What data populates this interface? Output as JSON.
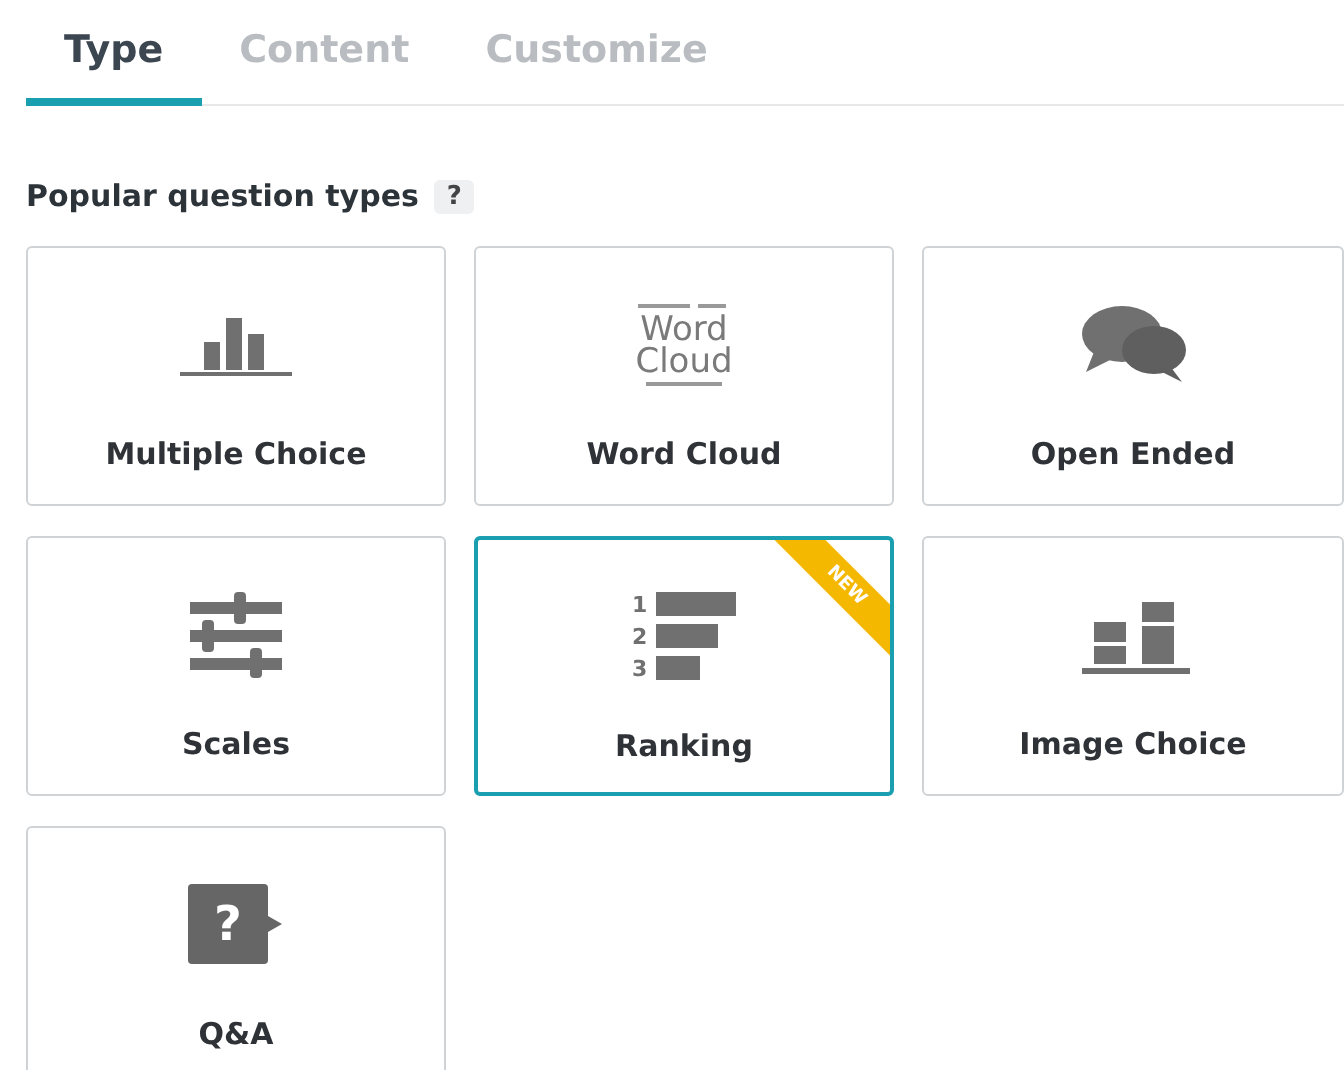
{
  "tabs": [
    {
      "label": "Type",
      "selected": true
    },
    {
      "label": "Content",
      "selected": false
    },
    {
      "label": "Customize",
      "selected": false
    }
  ],
  "section": {
    "title": "Popular question types",
    "help": "?"
  },
  "cards": [
    {
      "label": "Multiple Choice",
      "kind": "bars",
      "selected": false
    },
    {
      "label": "Word Cloud",
      "kind": "wordcloud",
      "selected": false,
      "icon_text": [
        "Word",
        "Cloud"
      ]
    },
    {
      "label": "Open Ended",
      "kind": "speech",
      "selected": false
    },
    {
      "label": "Scales",
      "kind": "sliders",
      "selected": false
    },
    {
      "label": "Ranking",
      "kind": "ranking",
      "selected": true,
      "badge": "NEW",
      "icon_text": [
        "1",
        "2",
        "3"
      ]
    },
    {
      "label": "Image Choice",
      "kind": "images",
      "selected": false
    },
    {
      "label": "Q&A",
      "kind": "qa",
      "selected": false,
      "icon_text": [
        "?"
      ]
    }
  ]
}
